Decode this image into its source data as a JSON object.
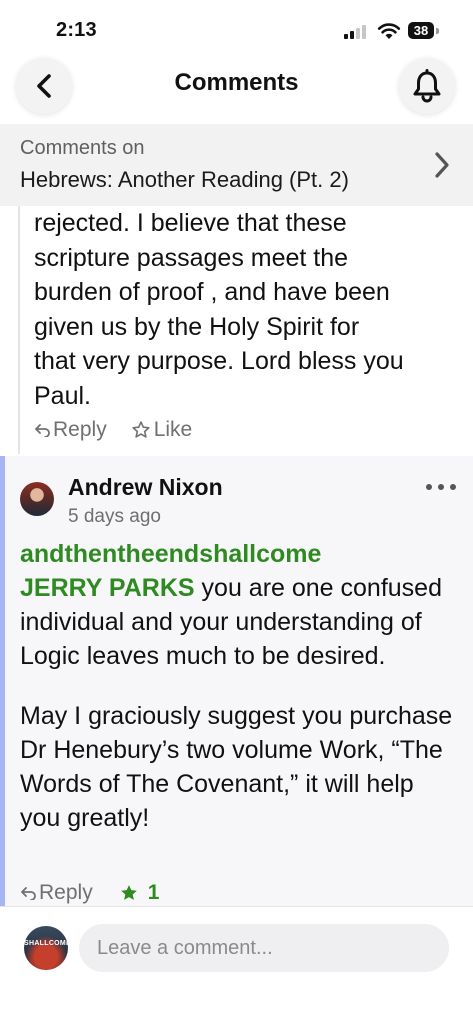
{
  "status_bar": {
    "time": "2:13",
    "battery": "38"
  },
  "nav": {
    "title": "Comments",
    "back_icon": "chevron-left-icon",
    "bell_icon": "bell-icon"
  },
  "context": {
    "label": "Comments on",
    "post_title": "Hebrews: Another Reading (Pt. 2)"
  },
  "comments": [
    {
      "text_lines": [
        "rejected. I believe that these",
        "scripture passages meet the",
        "burden of proof , and have been",
        "given us by the Holy Spirit for",
        "that very purpose. Lord bless you",
        "Paul."
      ],
      "reply_label": "Reply",
      "like_label": "Like"
    },
    {
      "author": "Andrew Nixon",
      "time_ago": "5 days ago",
      "mention_1": "andthentheendshallcome",
      "mention_2": "JERRY PARKS",
      "body_1_rest": " you are one confused individual and your understanding of Logic leaves much to be desired.",
      "body_2": "May I graciously suggest you purchase Dr Henebury’s two volume Work, “The Words of The Covenant,” it will help you greatly!",
      "reply_label": "Reply",
      "like_count": "1",
      "accent_color": "#2e8a21",
      "thread_color": "#a9b5f2"
    }
  ],
  "composer": {
    "placeholder": "Leave a comment...",
    "avatar_text": "SHALLCOME"
  }
}
